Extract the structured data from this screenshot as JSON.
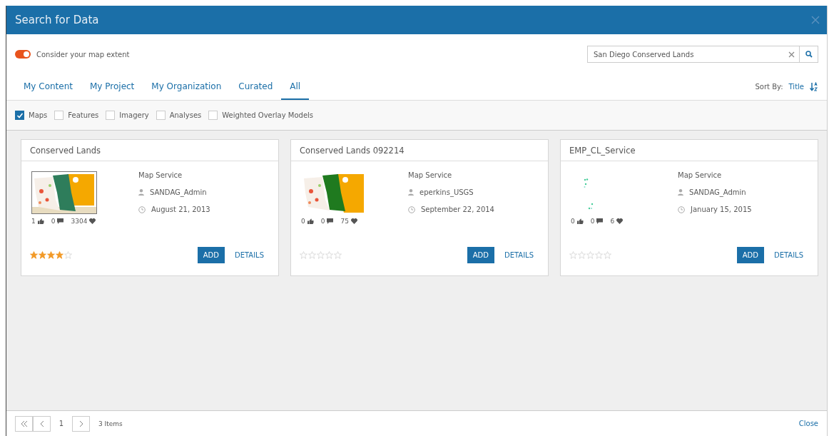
{
  "window": {
    "title": "Search for Data"
  },
  "extent_toggle": {
    "label": "Consider your map extent",
    "on": true
  },
  "search": {
    "value": "San Diego Conserved Lands"
  },
  "tabs": [
    {
      "label": "My Content",
      "selected": false
    },
    {
      "label": "My Project",
      "selected": false
    },
    {
      "label": "My Organization",
      "selected": false
    },
    {
      "label": "Curated",
      "selected": false
    },
    {
      "label": "All",
      "selected": true
    }
  ],
  "sort": {
    "label": "Sort By:",
    "value": "Title"
  },
  "filters": [
    {
      "label": "Maps",
      "checked": true
    },
    {
      "label": "Features",
      "checked": false
    },
    {
      "label": "Imagery",
      "checked": false
    },
    {
      "label": "Analyses",
      "checked": false
    },
    {
      "label": "Weighted Overlay Models",
      "checked": false
    }
  ],
  "cards": [
    {
      "title": "Conserved Lands",
      "type": "Map Service",
      "owner": "SANDAG_Admin",
      "date": "August 21, 2013",
      "likes": "1",
      "comments": "0",
      "views": "3304",
      "stars": 4,
      "add": "ADD",
      "details": "DETAILS"
    },
    {
      "title": "Conserved Lands 092214",
      "type": "Map Service",
      "owner": "eperkins_USGS",
      "date": "September 22, 2014",
      "likes": "0",
      "comments": "0",
      "views": "75",
      "stars": 0,
      "add": "ADD",
      "details": "DETAILS"
    },
    {
      "title": "EMP_CL_Service",
      "type": "Map Service",
      "owner": "SANDAG_Admin",
      "date": "January 15, 2015",
      "likes": "0",
      "comments": "0",
      "views": "6",
      "stars": 0,
      "add": "ADD",
      "details": "DETAILS"
    }
  ],
  "pagination": {
    "page": "1",
    "count": "3 Items"
  },
  "footer": {
    "close": "Close"
  }
}
